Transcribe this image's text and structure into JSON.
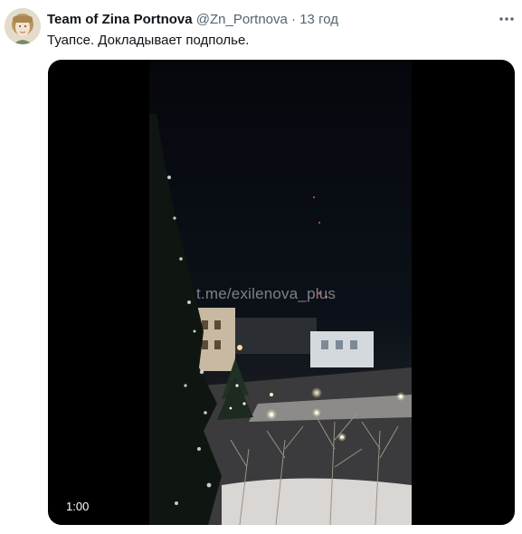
{
  "tweet": {
    "author_name": "Team of Zina Portnova",
    "handle": "@Zn_Portnova",
    "separator": "·",
    "time": "13 год",
    "text": "Туапсе. Докладывает подполье.",
    "more_icon": "more-horizontal-icon"
  },
  "media": {
    "watermark": "t.me/exilenova_plus",
    "duration": "1:00"
  },
  "colors": {
    "text_primary": "#0f1419",
    "text_secondary": "#536471",
    "media_background": "#000000"
  }
}
